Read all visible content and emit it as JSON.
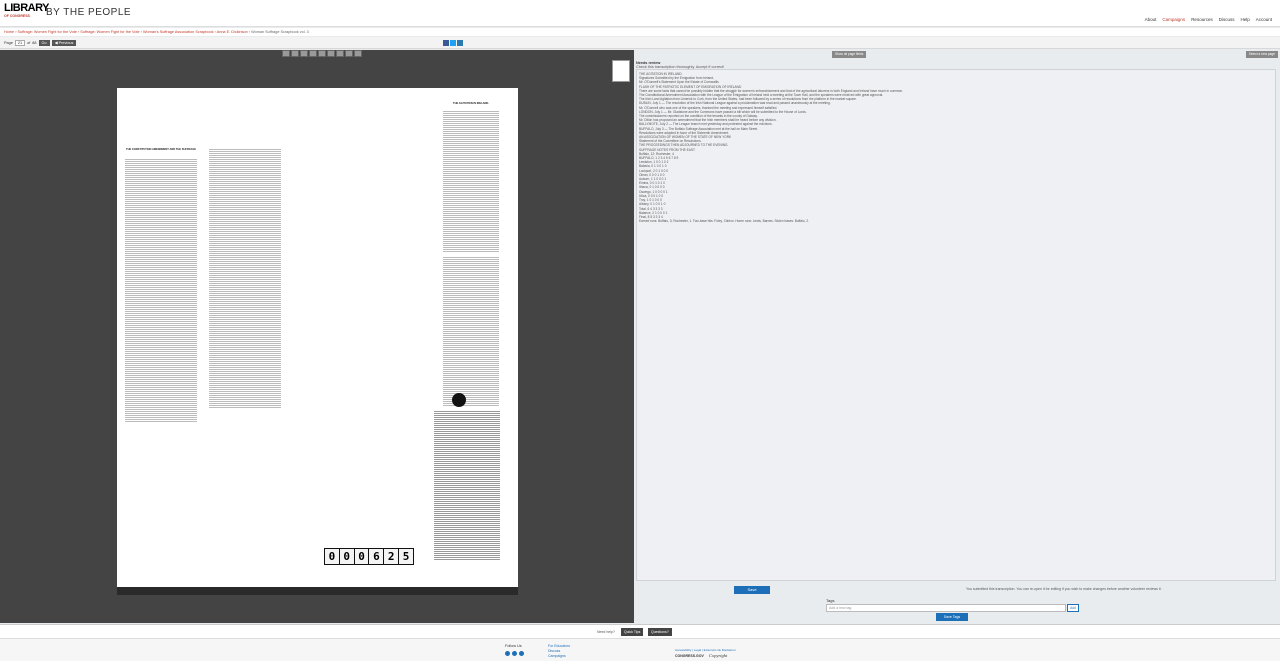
{
  "header": {
    "logo_text": "LIBRARY",
    "logo_sub": "OF CONGRESS",
    "brand": "BY THE PEOPLE",
    "nav": [
      "About",
      "Campaigns",
      "Resources",
      "Discuss",
      "Help",
      "Account"
    ]
  },
  "breadcrumbs": {
    "items": [
      "Home",
      "Suffrage: Women Fight for the Vote",
      "Suffrage: Women Fight for the Vote",
      "Woman's Suffrage Association Scrapbook",
      "Anna E. Dickinson"
    ],
    "current": "Woman Suffrage Scrapbook vol. 3"
  },
  "toolbar": {
    "page_label": "Page",
    "page_value": "21",
    "page_of": "of",
    "page_total": "88",
    "go_label": "Go",
    "prev_label": "◀ Previous"
  },
  "viewer": {
    "counter_digits": [
      "0",
      "0",
      "0",
      "6",
      "2",
      "5"
    ],
    "clip_heads": [
      "THE AGITATION IN IRELAND.",
      "THE CONSTITUTION AMENDMENT AND THE SUFFRAGE"
    ]
  },
  "panel": {
    "top_left_btn": "Show all page fields",
    "top_right_btn": "Select a new page",
    "status_label": "Needs review",
    "status_text": "Check this transcription thoroughly. Accept if correct!",
    "lines": [
      "THE AGITATION IN IRELAND.",
      "Signatures Submitted by the Emigration from Ireland,",
      "Mr. O'Donnell's Statement Upon the Estate of Cornwallis",
      "FLASH OF THE PATRIOTIC ELEMENT OF EMIGRATION OF IRELAND",
      "There are some facts that cannot be possibly hidden that the struggle for women's enfranchisement and that of the agricultural laborers in both England and Ireland have much in common.",
      "The Constitutional Amendment Association with the League of the Emigration of Ireland held a meeting at the Town Hall, and the speakers were received with great approval.",
      "The Irish Land Agitation from Limerick to Cork, from the United States, had been followed by a series of resolutions from the platform in the market square.",
      "DUBLIN, July 1 — The resolution of the Irish National League against a proclamation was read and passed unanimously at the meeting.",
      "Mr. O'Donnell who was one of the speakers, thanked the meeting and expressed himself satisfied.",
      "LONDON, July 1 — Mr. Gladstone and the Commons have passed a bill which will be submitted to the House of Lords.",
      "The commissioners reported on the condition of the tenants in the county of Galway.",
      "Mr. Dillon has proposed an amendment that the Irish members shall be heard before any division.",
      "BALLYMOTE, July 2 — The League branch met yesterday and protested against the evictions.",
      "BUFFALO, July 3 — The Buffalo Suffrage Association met at the hall on Main Street.",
      "Resolutions were adopted in favor of the Sixteenth Amendment.",
      "AN ASSOCIATION OF WOMEN OF THE STATE OF NEW YORK",
      "Statement of the Committee on Resolutions.",
      "THE PROCEEDINGS THEN ADJOURNED TO THE EVENING.",
      "SUFFRAGE NOTES FROM THE EAST.",
      "Buffalo, 12; Rochester, 4",
      "BUFFALO, 1 2 3 4 5 6 7 8 9",
      "Lewiston, 1 0 0 1 0 2",
      "Batavia, 0 1 0 0 1 0",
      "Lockport, 2 0 1 0 0 0",
      "Olean, 0 0 0 1 0 0",
      "Auburn, 1 1 0 0 0 1",
      "Elmira, 0 0 1 0 1 0",
      "Ithaca, 0 1 0 0 0 0",
      "Oswego, 1 0 0 0 0 1",
      "Utica, 0 0 0 1 0 0",
      "Troy, 1 0 1 0 0 0",
      "Albany, 0 1 0 0 1 0",
      "Total, 6 4 3 3 3 3",
      "Balance, 2 1 0 0 0 1",
      "Final, 8 5 3 3 3 4",
      "Earned runs: Buffalo, 3; Rochester, 1. Two-base hits: Foley, Clinton. Home runs: Lewis, Barnes. Stolen bases: Buffalo, 2."
    ]
  },
  "actions": {
    "save_label": "Save",
    "note": "You submitted this transcription. You can re-open it for editing if you wish to make changes before another volunteer reviews it.",
    "tags_label": "Tags",
    "tag_placeholder": "Add a new tag",
    "tag_add": "Add",
    "save_tags": "Save Tags"
  },
  "help": {
    "text": "Need help?",
    "quick_tips": "Quick Tips",
    "questions": "Questions?"
  },
  "footer": {
    "follow": "Follow Us",
    "links": [
      "For Educators",
      "Discuss",
      "Campaigns"
    ],
    "legal": "Accessibility | Legal | External Link Disclaimer",
    "loc_mark": "CONGRESS.GOV",
    "copyright_mark": "Copyright"
  }
}
